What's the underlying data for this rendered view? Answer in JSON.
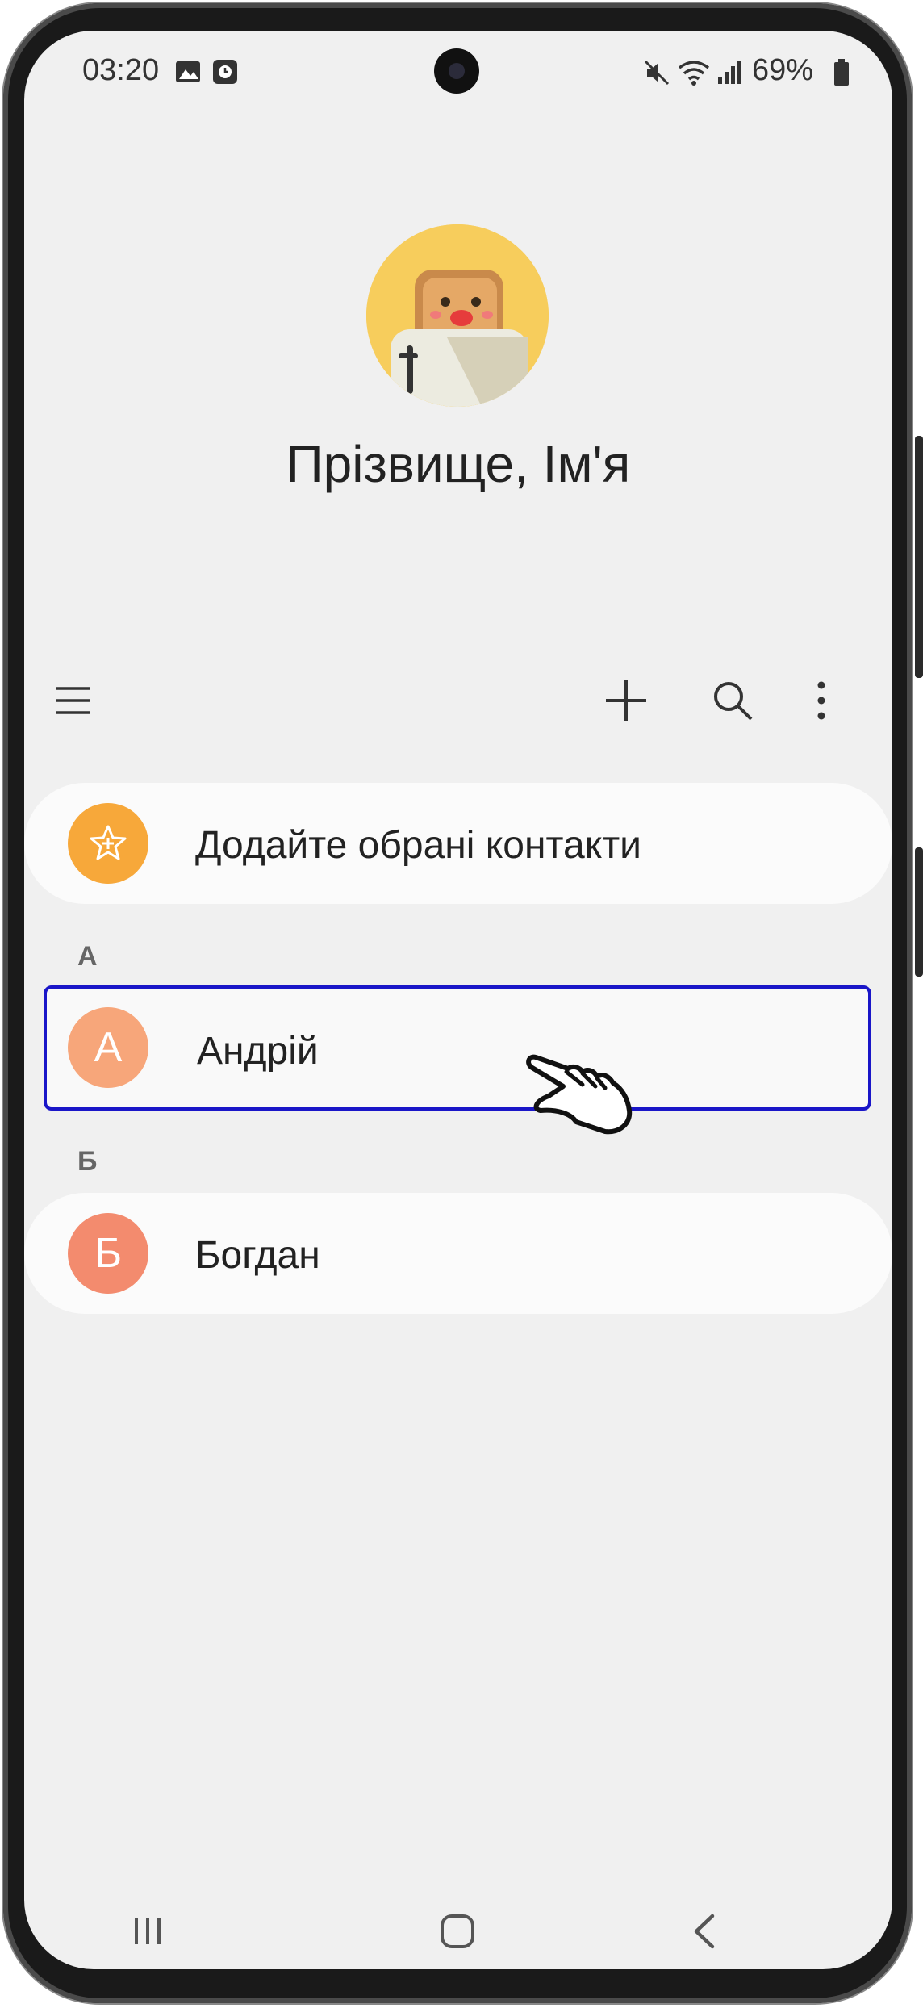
{
  "status_bar": {
    "time": "03:20",
    "battery": "69%"
  },
  "profile": {
    "name": "Прізвище, Ім'я"
  },
  "favorites": {
    "label": "Додайте обрані контакти"
  },
  "sections": [
    {
      "letter": "А",
      "contact": {
        "initial": "А",
        "name": "Андрій"
      }
    },
    {
      "letter": "Б",
      "contact": {
        "initial": "Б",
        "name": "Богдан"
      }
    }
  ],
  "colors": {
    "selection_border": "#1a16c8",
    "favorites_avatar": "#f7a83a",
    "contact_a": "#f7a67a",
    "contact_b": "#f38b6e"
  },
  "icons": {
    "toolbar": [
      "menu-icon",
      "add-icon",
      "search-icon",
      "more-icon"
    ],
    "nav": [
      "recents-icon",
      "home-icon",
      "back-icon"
    ]
  }
}
